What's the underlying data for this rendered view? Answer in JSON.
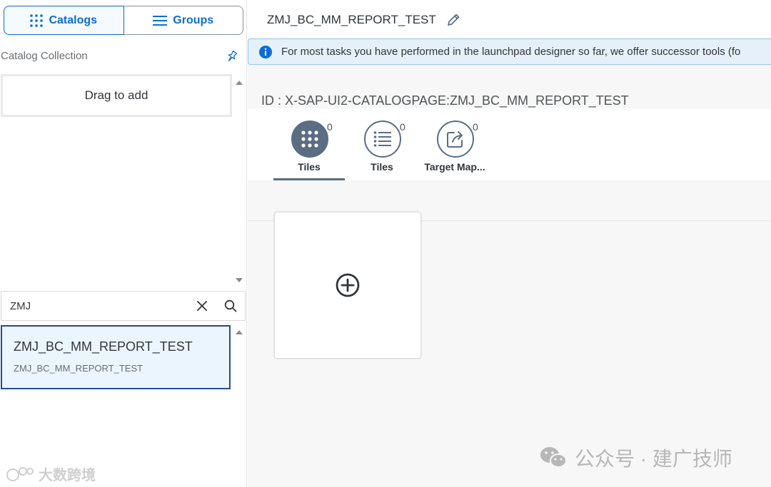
{
  "sidebar": {
    "segmented": [
      {
        "label": "Catalogs",
        "icon": "grid-icon",
        "selected": true
      },
      {
        "label": "Groups",
        "icon": "list-icon",
        "selected": false
      }
    ],
    "collection_title": "Catalog Collection",
    "dropzone_text": "Drag to add",
    "search": {
      "value": "ZMJ"
    },
    "result": {
      "title": "ZMJ_BC_MM_REPORT_TEST",
      "subtitle": "ZMJ_BC_MM_REPORT_TEST"
    },
    "watermark": "大数跨境"
  },
  "main": {
    "title": "ZMJ_BC_MM_REPORT_TEST",
    "info_message": "For most tasks you have performed in the launchpad designer so far, we offer successor tools (fo",
    "id_label": "ID : X-SAP-UI2-CATALOGPAGE:ZMJ_BC_MM_REPORT_TEST",
    "tabs": [
      {
        "label": "Tiles",
        "count": "0",
        "icon": "tiles-grid-icon",
        "active": true
      },
      {
        "label": "Tiles",
        "count": "0",
        "icon": "list-icon",
        "active": false
      },
      {
        "label": "Target Map...",
        "count": "0",
        "icon": "share-icon",
        "active": false
      }
    ],
    "watermark": "公众号 · 建广技师"
  },
  "colors": {
    "accent": "#0a6ed1",
    "tab_active": "#5a6d82",
    "selected_bg": "#ebf5fe",
    "info_bg": "#e5f0fa"
  }
}
